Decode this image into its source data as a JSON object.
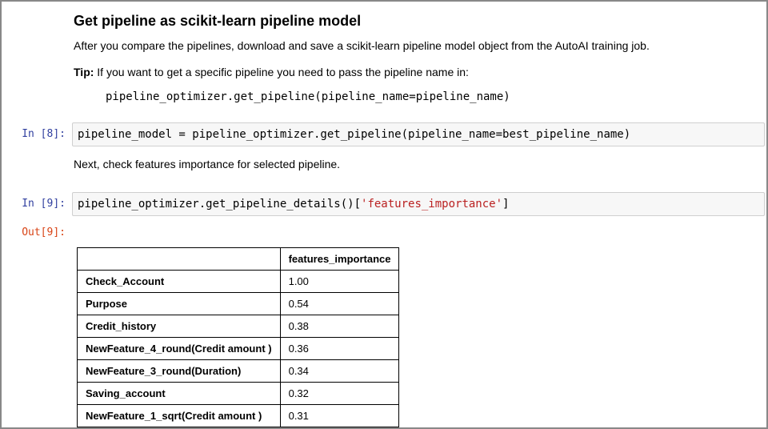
{
  "heading": "Get pipeline as scikit-learn pipeline model",
  "intro": "After you compare the pipelines, download and save a scikit-learn pipeline model object from the AutoAI training job.",
  "tip_label": "Tip:",
  "tip_text": " If you want to get a specific pipeline you need to pass the pipeline name in:",
  "inline_code": "pipeline_optimizer.get_pipeline(pipeline_name=pipeline_name)",
  "cell8": {
    "prompt": "In [8]:",
    "code": "pipeline_model = pipeline_optimizer.get_pipeline(pipeline_name=best_pipeline_name)"
  },
  "between_text": "Next, check features importance for selected pipeline.",
  "cell9": {
    "prompt_in": "In [9]:",
    "prompt_out": "Out[9]:",
    "code_pre": "pipeline_optimizer.get_pipeline_details()[",
    "code_str": "'features_importance'",
    "code_post": "]"
  },
  "chart_data": {
    "type": "table",
    "columns": [
      "",
      "features_importance"
    ],
    "rows": [
      {
        "index": "Check_Account",
        "value": "1.00"
      },
      {
        "index": "Purpose",
        "value": "0.54"
      },
      {
        "index": "Credit_history",
        "value": "0.38"
      },
      {
        "index": "NewFeature_4_round(Credit amount )",
        "value": "0.36"
      },
      {
        "index": "NewFeature_3_round(Duration)",
        "value": "0.34"
      },
      {
        "index": "Saving_account",
        "value": "0.32"
      },
      {
        "index": "NewFeature_1_sqrt(Credit amount )",
        "value": "0.31"
      }
    ]
  }
}
